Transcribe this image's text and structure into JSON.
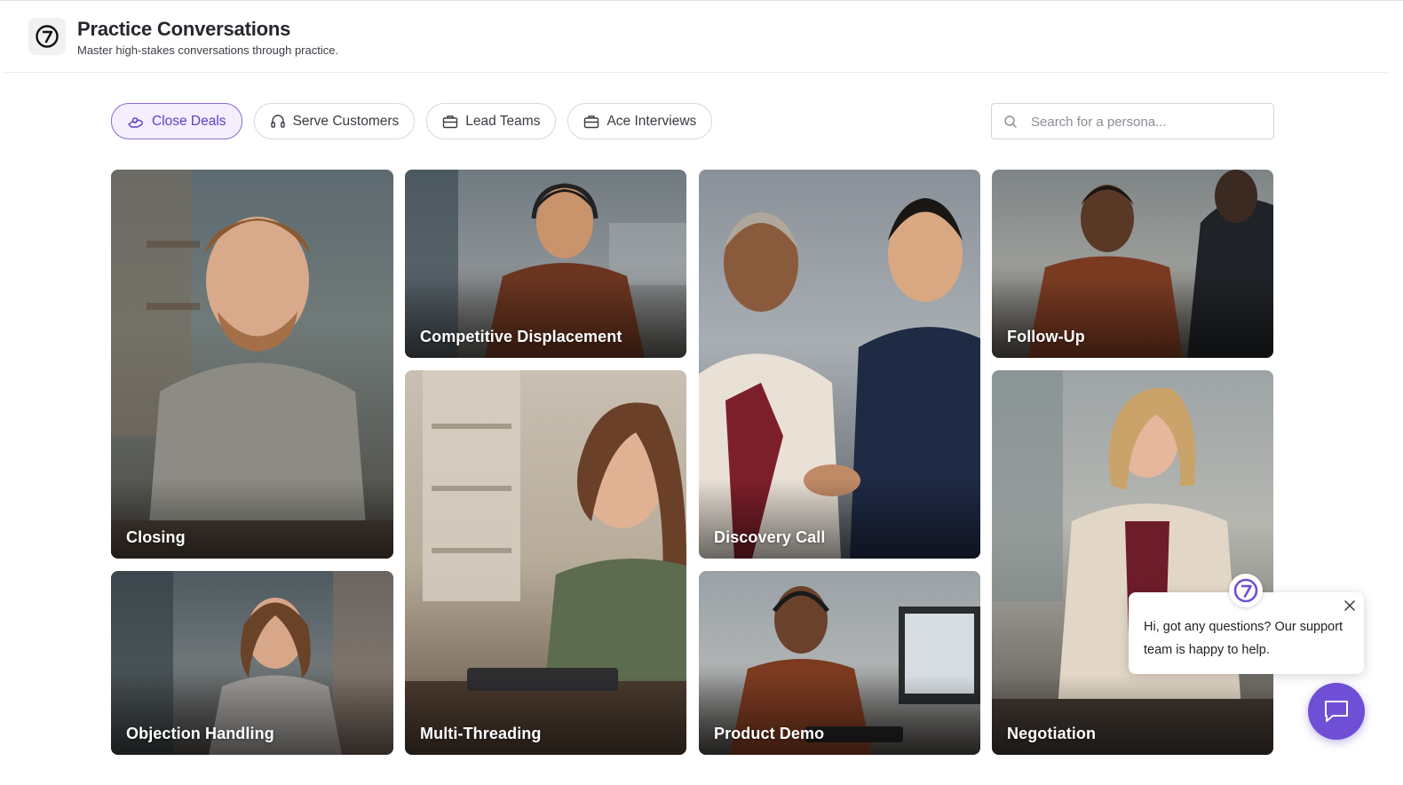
{
  "header": {
    "title": "Practice Conversations",
    "subtitle": "Master high-stakes conversations through practice."
  },
  "tabs": [
    {
      "label": "Close Deals",
      "icon": "handshake-icon",
      "active": true
    },
    {
      "label": "Serve Customers",
      "icon": "headset-icon",
      "active": false
    },
    {
      "label": "Lead Teams",
      "icon": "briefcase-icon",
      "active": false
    },
    {
      "label": "Ace Interviews",
      "icon": "briefcase-icon",
      "active": false
    }
  ],
  "search": {
    "placeholder": "Search for a persona...",
    "value": ""
  },
  "personas": [
    {
      "label": "Closing"
    },
    {
      "label": "Competitive Displacement"
    },
    {
      "label": "Discovery Call"
    },
    {
      "label": "Follow-Up"
    },
    {
      "label": "Objection Handling"
    },
    {
      "label": "Multi-Threading"
    },
    {
      "label": "Product Demo"
    },
    {
      "label": "Negotiation"
    }
  ],
  "chat": {
    "message": "Hi, got any questions? Our support team is happy to help."
  },
  "colors": {
    "accent": "#6f4fd6",
    "active_tab_bg": "#f3effd",
    "active_tab_text": "#5f3fc2"
  }
}
